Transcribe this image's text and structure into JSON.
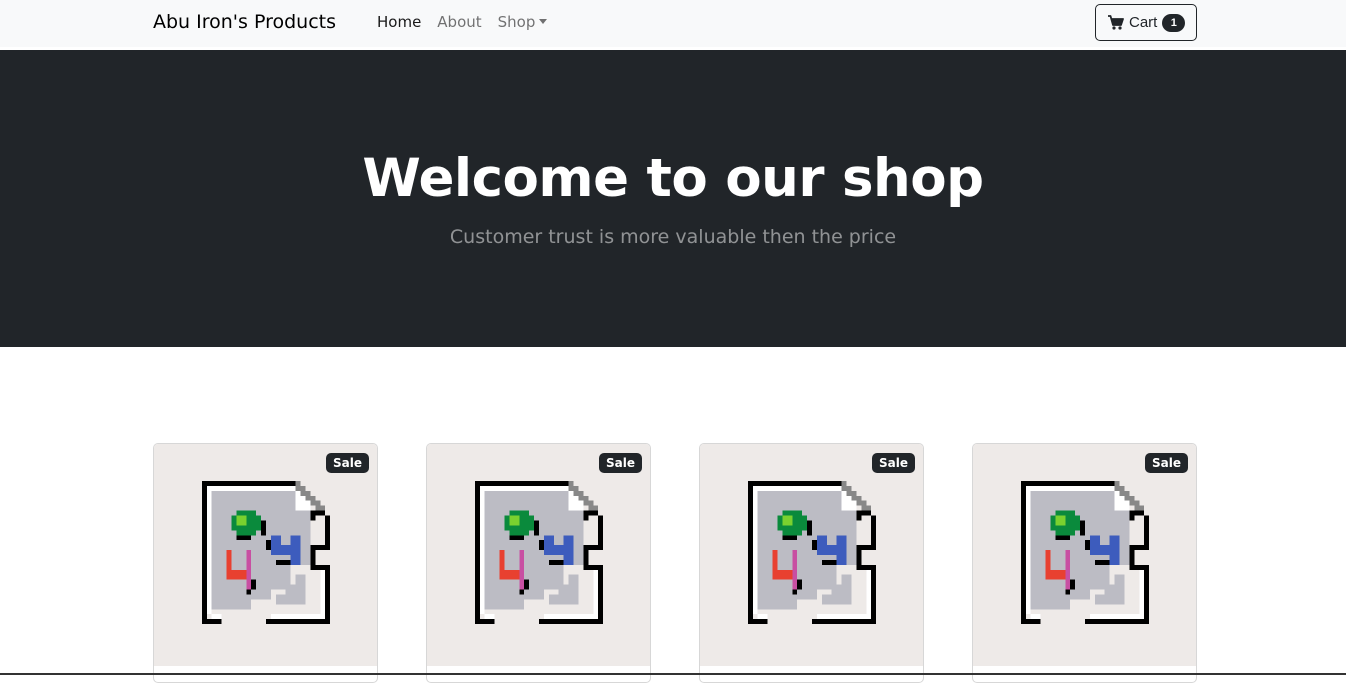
{
  "navbar": {
    "brand": "Abu Iron's Products",
    "links": [
      {
        "label": "Home",
        "active": true
      },
      {
        "label": "About",
        "active": false
      },
      {
        "label": "Shop",
        "active": false,
        "dropdown": true
      }
    ],
    "cart": {
      "label": "Cart",
      "count": "1",
      "icon": "cart-icon"
    }
  },
  "hero": {
    "title": "Welcome to our shop",
    "subtitle": "Customer trust is more valuable then the price"
  },
  "products": [
    {
      "badge": "Sale",
      "image_icon": "broken-image-icon"
    },
    {
      "badge": "Sale",
      "image_icon": "broken-image-icon"
    },
    {
      "badge": "Sale",
      "image_icon": "broken-image-icon"
    },
    {
      "badge": "Sale",
      "image_icon": "broken-image-icon"
    }
  ],
  "colors": {
    "navbar_bg": "#f8f9fa",
    "hero_bg": "#212529",
    "badge_bg": "#212529",
    "image_placeholder_bg": "#eeeae8"
  }
}
